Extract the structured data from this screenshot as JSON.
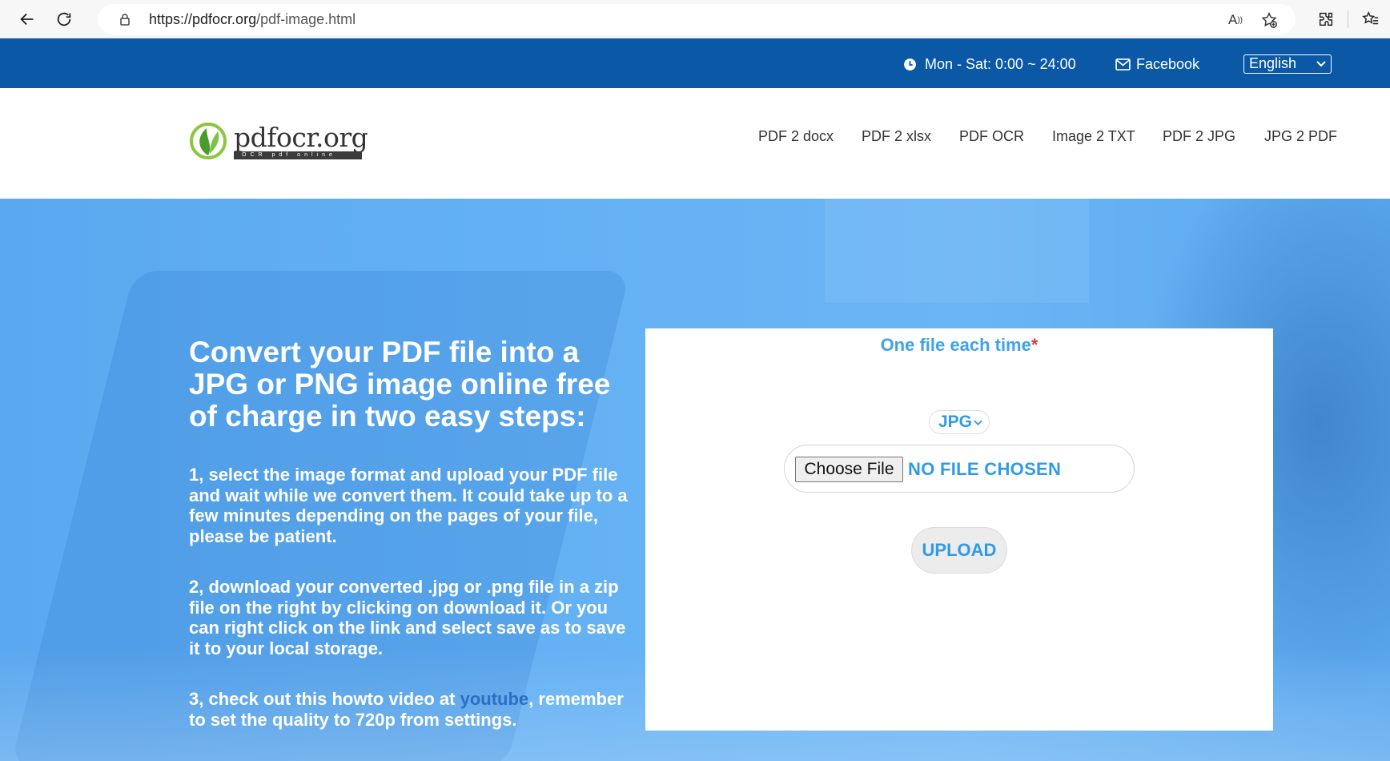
{
  "browser": {
    "url_host": "https://pdfocr.org",
    "url_path": "/pdf-image.html"
  },
  "topbar": {
    "hours": "Mon - Sat: 0:00 ~ 24:00",
    "facebook": "Facebook",
    "language": "English"
  },
  "header": {
    "logo_text": "pdfocr.org",
    "logo_tagline": "OCR pdf online",
    "menu": [
      "PDF 2 docx",
      "PDF 2 xlsx",
      "PDF OCR",
      "Image 2 TXT",
      "PDF 2 JPG",
      "JPG 2 PDF"
    ]
  },
  "hero": {
    "title": "Convert your PDF file into a JPG or PNG image online free of charge in two easy steps:",
    "step1": "1, select the image format and upload your PDF file and wait while we convert them. It could take up to a few minutes depending on the pages of your file, please be patient.",
    "step2": "2, download your converted .jpg or .png file in a zip file on the right by clicking on download it. Or you can right click on the link and select save as to save it to your local storage.",
    "step3_before": "3, check out this howto video at ",
    "step3_link": "youtube",
    "step3_after": ", remember to set the quality to 720p from settings."
  },
  "panel": {
    "title": "One file each time",
    "required_mark": "*",
    "format": "JPG",
    "choose_file": "Choose File",
    "no_file": "NO FILE CHOSEN",
    "upload": "UPLOAD"
  },
  "colors": {
    "topbar": "#0b58a6",
    "hero": "#63b0f4",
    "accent": "#2f9be6"
  }
}
